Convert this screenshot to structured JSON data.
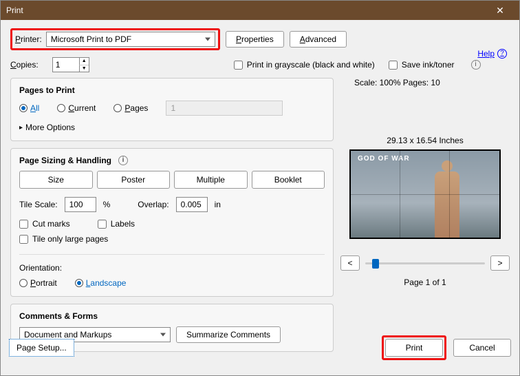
{
  "window": {
    "title": "Print"
  },
  "top": {
    "printer_label": "Printer:",
    "printer_value": "Microsoft Print to PDF",
    "properties": "Properties",
    "advanced": "Advanced",
    "help": "Help"
  },
  "mid": {
    "copies_label": "Copies:",
    "copies_value": "1",
    "grayscale": "Print in grayscale (black and white)",
    "saveink": "Save ink/toner"
  },
  "pages": {
    "heading": "Pages to Print",
    "all": "All",
    "current": "Current",
    "pages": "Pages",
    "pages_value": "1",
    "more": "More Options"
  },
  "sizing": {
    "heading": "Page Sizing & Handling",
    "size": "Size",
    "poster": "Poster",
    "multiple": "Multiple",
    "booklet": "Booklet",
    "tile_label": "Tile Scale:",
    "tile_value": "100",
    "tile_unit": "%",
    "overlap_label": "Overlap:",
    "overlap_value": "0.005",
    "overlap_unit": "in",
    "cutmarks": "Cut marks",
    "labels": "Labels",
    "tileonly": "Tile only large pages",
    "orientation": "Orientation:",
    "portrait": "Portrait",
    "landscape": "Landscape"
  },
  "cf": {
    "heading": "Comments & Forms",
    "value": "Document and Markups",
    "summarize": "Summarize Comments"
  },
  "preview": {
    "scale_line": "Scale: 100% Pages: 10",
    "dimensions": "29.13 x 16.54 Inches",
    "logo": "GOD OF WAR",
    "prev": "<",
    "next": ">",
    "page_of": "Page 1 of 1"
  },
  "footer": {
    "page_setup": "Page Setup...",
    "print": "Print",
    "cancel": "Cancel"
  }
}
